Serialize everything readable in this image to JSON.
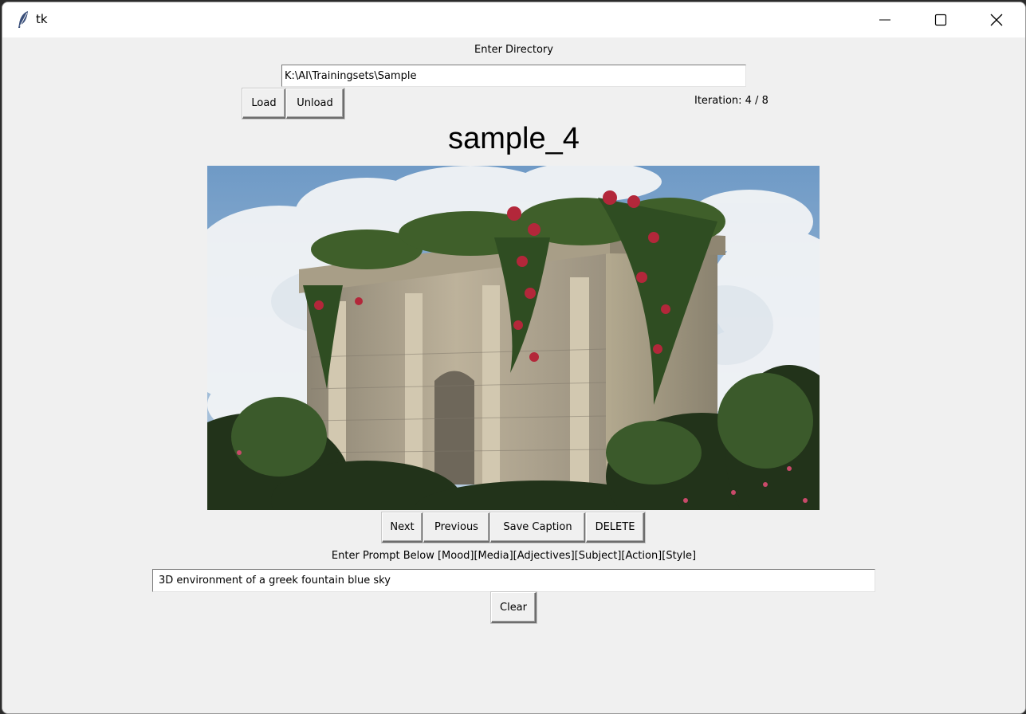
{
  "window": {
    "title": "tk"
  },
  "directory": {
    "label": "Enter Directory",
    "value": "K:\\AI\\Trainingsets\\Sample"
  },
  "buttons": {
    "load": "Load",
    "unload": "Unload",
    "next": "Next",
    "previous": "Previous",
    "save_caption": "Save Caption",
    "delete": "DELETE",
    "clear": "Clear"
  },
  "iteration": {
    "text": "Iteration: 4 / 8"
  },
  "image": {
    "title": "sample_4"
  },
  "prompt": {
    "label": "Enter Prompt Below [Mood][Media][Adjectives][Subject][Action][Style]",
    "value": "3D environment of a greek fountain blue sky"
  },
  "icons": {
    "app": "feather-icon",
    "minimize": "minimize-icon",
    "maximize": "maximize-icon",
    "close": "close-icon"
  }
}
